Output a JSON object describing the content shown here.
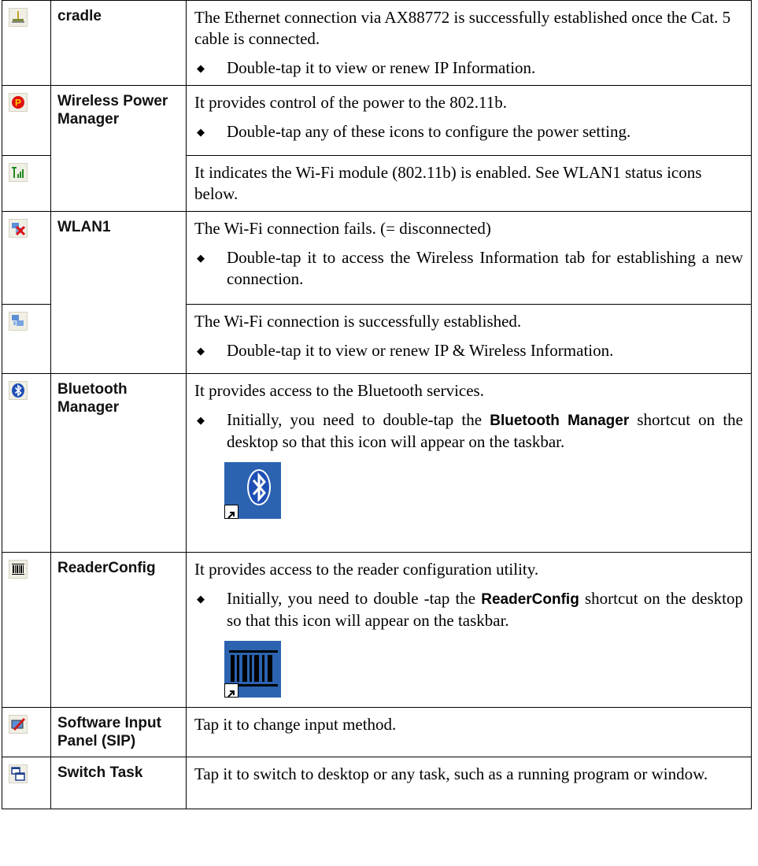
{
  "rows": [
    {
      "name": "cradle",
      "desc": "The Ethernet connection via AX88772 is successfully established once the Cat. 5 cable is connected.",
      "bullet": "Double-tap it to view or renew IP Information.",
      "icon": "ethernet-cradle-icon"
    },
    {
      "name": "Wireless Power Manager",
      "desc": "It provides control of the power to the 802.11b.",
      "bullet": "Double-tap any of these icons to configure the power setting.",
      "icon": "power-manager-icon"
    },
    {
      "desc": "It indicates the Wi-Fi module (802.11b) is enabled. See WLAN1 status icons below.",
      "icon": "wifi-signal-icon"
    },
    {
      "name": "WLAN1",
      "desc": "The Wi-Fi connection fails. (= disconnected)",
      "bullet": "Double-tap it to access the Wireless Information tab for establishing a new connection.",
      "icon": "wlan-disconnected-icon"
    },
    {
      "desc": "The Wi-Fi connection is successfully established.",
      "bullet": "Double-tap it to view or renew IP & Wireless Information.",
      "icon": "wlan-connected-icon"
    },
    {
      "name": "Bluetooth Manager",
      "desc": "It provides access to the Bluetooth services.",
      "bullet_pre": "Initially, you need to double-tap the",
      "bullet_bold": "Bluetooth Manager",
      "bullet_post": "shortcut on the desktop so that this icon will appear on the taskbar.",
      "icon": "bluetooth-icon"
    },
    {
      "name": "ReaderConfig",
      "desc": "It provides access to the reader configuration utility.",
      "bullet_pre": "Initially, you need to double -tap the",
      "bullet_bold": "ReaderConfig",
      "bullet_post": "shortcut on the desktop so that this icon will appear on the taskbar.",
      "icon": "barcode-icon"
    },
    {
      "name": "Software Input Panel (SIP)",
      "desc": "Tap it to change input method.",
      "icon": "sip-pen-icon"
    },
    {
      "name": "Switch Task",
      "desc": "Tap it to switch to desktop or any task, such as a running program or window.",
      "icon": "switch-task-icon"
    }
  ],
  "colors": {
    "border": "#000000",
    "icon_bg": "#f0efe6",
    "shortcut_bg": "#2b63b0"
  }
}
